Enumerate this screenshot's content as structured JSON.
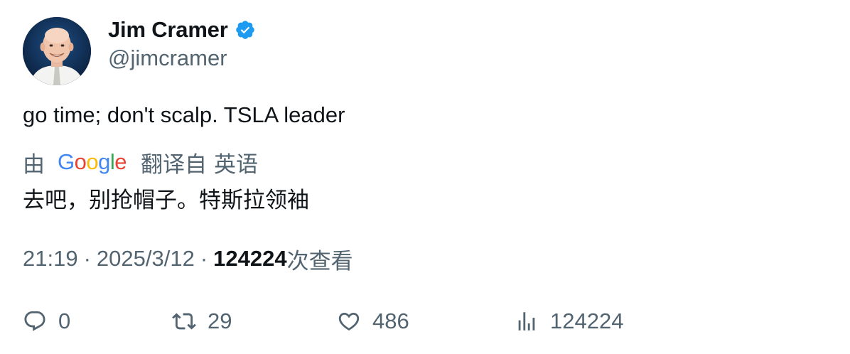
{
  "author": {
    "display_name": "Jim Cramer",
    "handle": "@jimcramer"
  },
  "tweet": {
    "text": "go time; don't scalp. TSLA leader"
  },
  "translation": {
    "by_label": "由",
    "provider": "Google",
    "translated_from_label": "翻译自",
    "source_language": "英语",
    "text": "去吧，别抢帽子。特斯拉领袖"
  },
  "meta": {
    "time": "21:19",
    "date": "2025/3/12",
    "separator": "·",
    "views": "124224",
    "views_label": "次查看"
  },
  "actions": {
    "replies": "0",
    "retweets": "29",
    "likes": "486",
    "views": "124224"
  },
  "colors": {
    "primary_text": "#0f1419",
    "secondary_text": "#536471",
    "verified_badge": "#1d9bf0"
  },
  "icons": {
    "verified": "verified-badge-icon",
    "reply": "reply-icon",
    "retweet": "retweet-icon",
    "like": "heart-icon",
    "views": "bar-chart-icon"
  }
}
